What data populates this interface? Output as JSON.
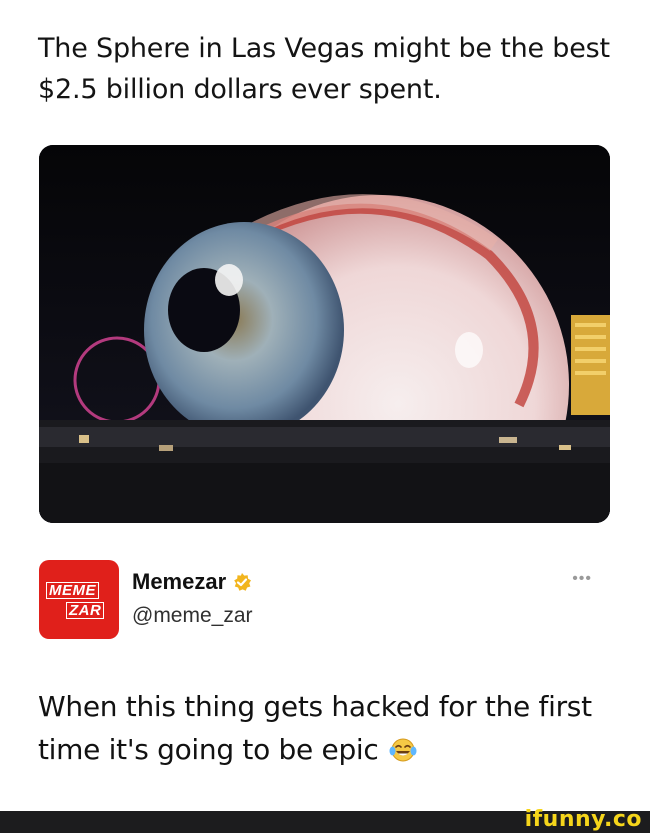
{
  "post": {
    "title": "The Sphere in Las Vegas might be the best $2.5 billion dollars ever spent.",
    "image_icon": "sphere-eye-photo"
  },
  "author": {
    "avatar_line1": "MEME",
    "avatar_line2": "ZAR",
    "name": "Memezar",
    "handle": "@meme_zar",
    "more": "•••",
    "verified_color": "#f2b51e",
    "avatar_color": "#e0201b"
  },
  "tweet": {
    "text": "When this thing gets hacked for the first time it's going to be epic",
    "emoji_icon": "tears-of-joy-emoji-icon"
  },
  "footer": {
    "brand": "ifunny.co",
    "brand_color": "#f5d51b"
  }
}
